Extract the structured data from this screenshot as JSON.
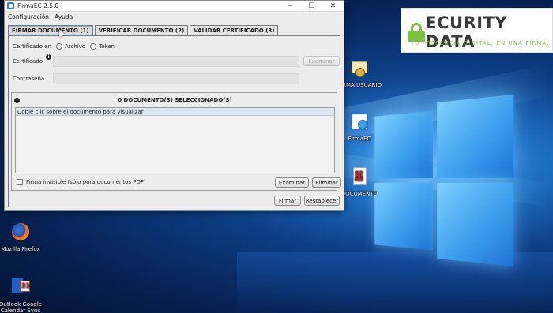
{
  "window": {
    "title": "FirmaEC 2.5.0",
    "minimize": "─",
    "maximize": "☐",
    "close": "✕"
  },
  "menu": [
    {
      "underline": "C",
      "rest": "onfiguración"
    },
    {
      "underline": "A",
      "rest": "yuda"
    }
  ],
  "tabs": [
    {
      "label": "FIRMAR DOCUMENTO (1)",
      "active": true
    },
    {
      "label": "VERIFICAR DOCUMENTO (2)",
      "active": false
    },
    {
      "label": "VALIDAR CERTIFICADO (3)",
      "active": false
    }
  ],
  "sign_form": {
    "certificate_in_label": "Certificado en",
    "option_file": "Archivo",
    "option_token": "Token",
    "certificate_label": "Certificado",
    "certificate_value": "",
    "browse_cert_button": "Examinar",
    "password_label": "Contraseña",
    "password_value": ""
  },
  "documents": {
    "title": "0 DOCUMENTO(S) SELECCIONADO(S)",
    "hint": "Doble clic sobre el documento para visualizar",
    "invisible_signature_label": "Firma invisible (sólo para documentos PDF)",
    "browse_button": "Examinar",
    "remove_button": "Eliminar"
  },
  "actions": {
    "sign_button": "Firmar",
    "reset_button": "Restablecer"
  },
  "brand": {
    "name": "ECURITY DATA",
    "tagline": "TU PRESENCIA DIGITAL, EN UNA FIRMA.",
    "accent": "#7dc142"
  },
  "desktop_icons": {
    "firma_usuario": "FIRMA USUARIO",
    "firmaec": "FirmaEC",
    "documento": "DOCUMENTO",
    "firefox": "Mozilla Firefox",
    "outlook": "Outlook Google Calendar Sync"
  }
}
